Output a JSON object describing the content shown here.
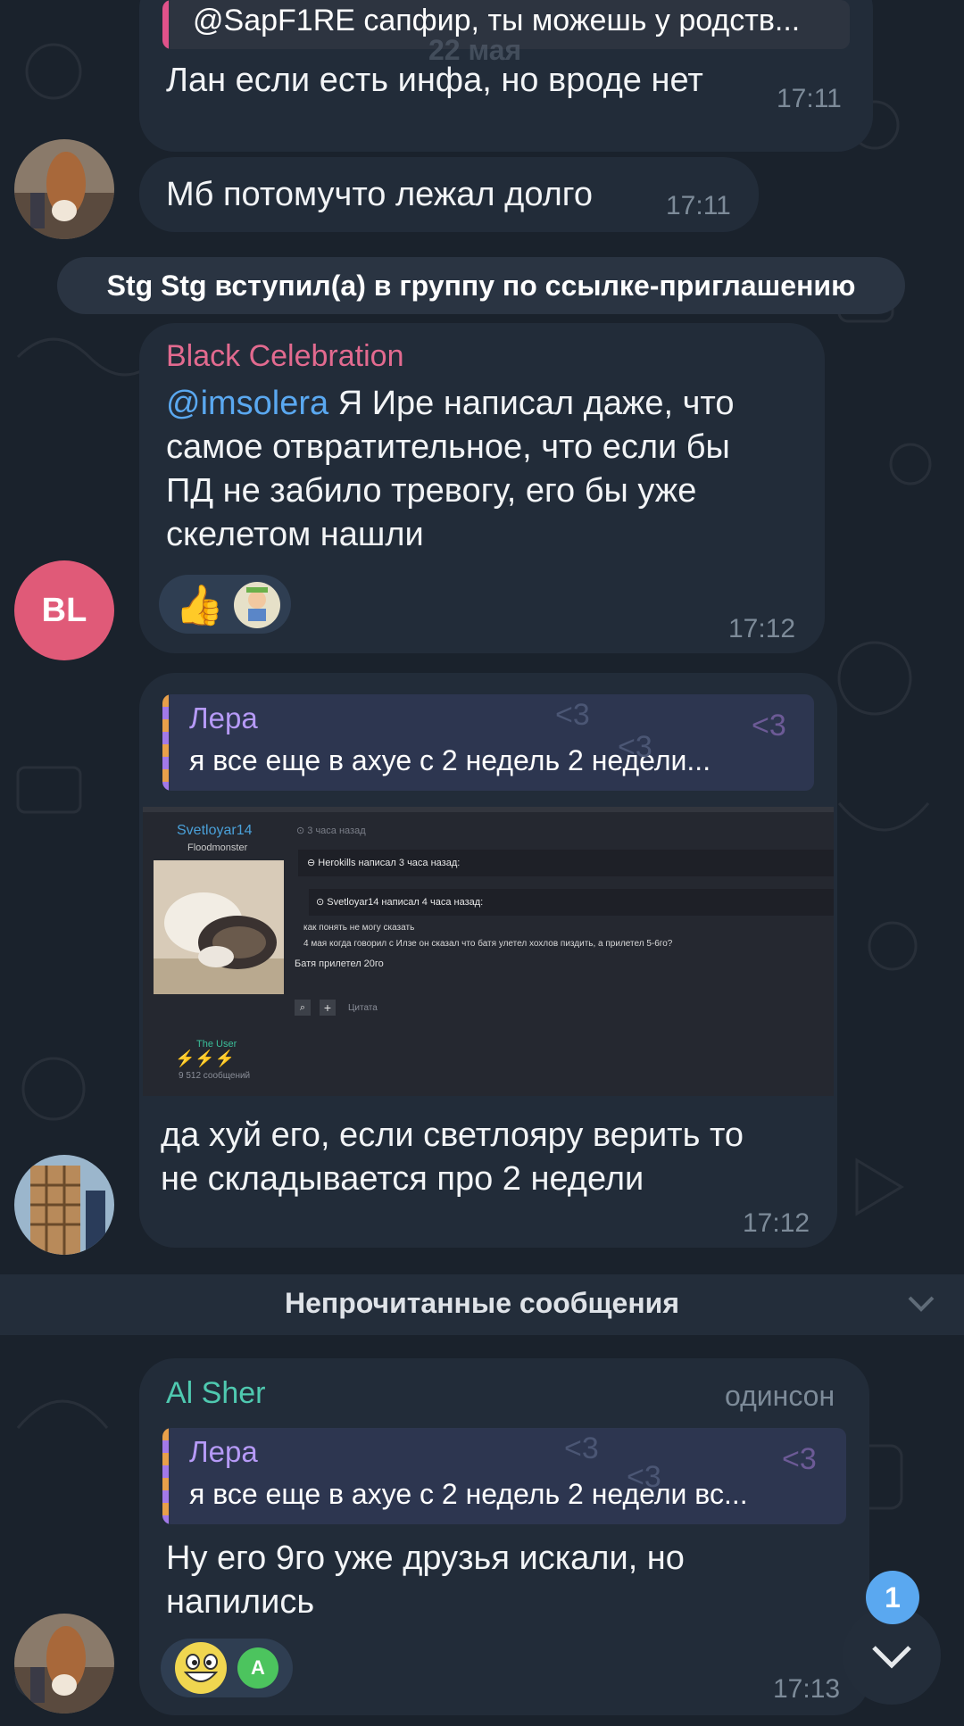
{
  "chat": {
    "top_reply": {
      "text": "@SapF1RE сапфир, ты можешь у родств..."
    },
    "floating_date": "22 мая",
    "messages": [
      {
        "text": "Лан если есть инфа, но вроде нет",
        "time": "17:11"
      },
      {
        "text": "Мб потомучто лежал долго",
        "time": "17:11"
      },
      {
        "sender": "Black Celebration",
        "sender_color": "#e26a8f",
        "mention": "@imsolera",
        "text_lines": [
          " Я Ире написал даже, что",
          "самое отвратительное, что если бы",
          "ПД не забило тревогу, его бы уже",
          "скелетом нашли"
        ],
        "time": "17:12",
        "avatar_initials": "BL",
        "avatar_color": "#e05a78"
      },
      {
        "reply_name": "Лера",
        "reply_text": "я все еще в ахуе с 2 недель 2 недели...",
        "text_lines": [
          "да хуй его, если светлояру верить то",
          "не складывается про 2 недели"
        ],
        "time": "17:12",
        "forum": {
          "user": "Svetloyar14",
          "user_sub": "Floodmonster",
          "posted": "3 часа назад",
          "quote1_author": "Herokills написал 3 часа назад:",
          "quote2_author": "Svetloyar14 написал 4 часа назад:",
          "quote2_line1": "как понять не могу сказать",
          "quote2_line2": "4 мая когда говорил с Илзе он сказал что батя улетел хохлов пиздить, а прилетел 5-6го?",
          "reply_line": "Батя прилетел 20го",
          "cite": "Цитата",
          "role": "The User",
          "posts": "9 512 сообщений"
        }
      },
      {
        "sender": "Al Sher",
        "sender_color": "#4fc9b0",
        "sender_title": "одинсон",
        "reply_name": "Лера",
        "reply_text": "я все еще в ахуе с 2 недель 2 недели вс...",
        "text_lines": [
          "Ну его 9го уже друзья искали, но",
          "напились"
        ],
        "time": "17:13",
        "reaction_avatar_letter": "A"
      }
    ],
    "service_message": "Stg Stg вступил(а) в группу по ссылке-приглашению",
    "unread_divider": "Непрочитанные сообщения",
    "unread_count": "1",
    "hearts": "<3",
    "colors": {
      "accent": "#5aa8f0",
      "bubble": "#222c39",
      "background": "#1a222c"
    }
  }
}
